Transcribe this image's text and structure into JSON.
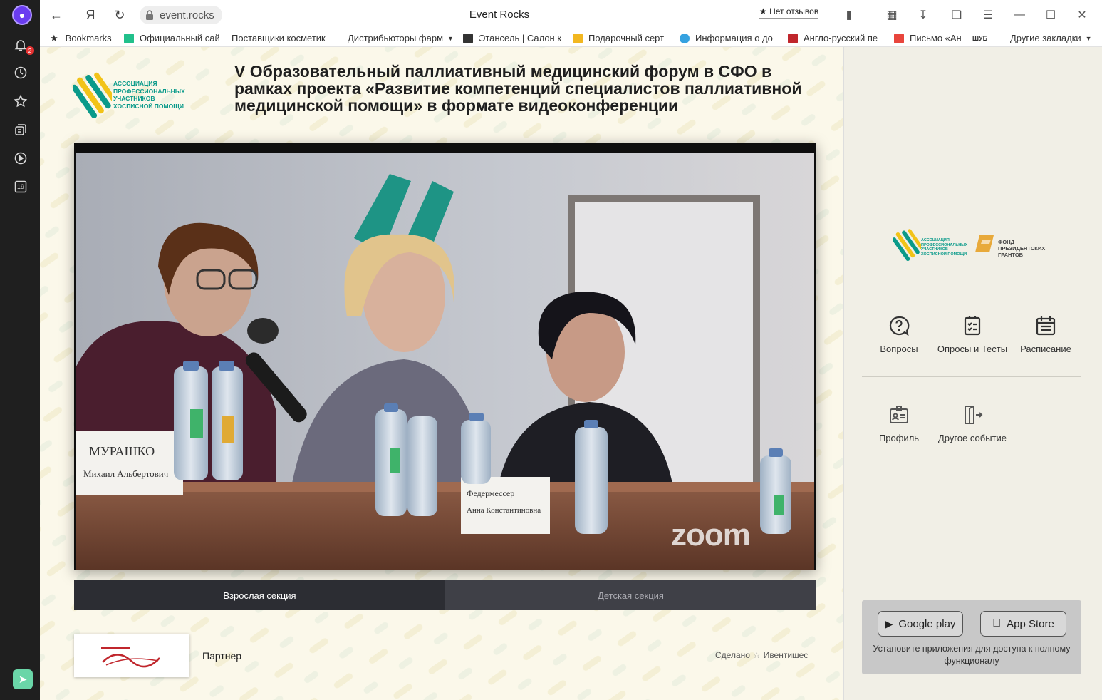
{
  "browser": {
    "tab_title": "Event Rocks",
    "address": "event.rocks",
    "yandex_btn": "Я",
    "reviews": "Нет отзывов",
    "notification_count": "2",
    "calendar_day": "19"
  },
  "bookmarks": [
    {
      "label": "Bookmarks",
      "color": "#333333"
    },
    {
      "label": "Официальный сай",
      "color": "#21c08b"
    },
    {
      "label": "Поставщики косметик",
      "color": "#ffffff"
    },
    {
      "label": "Дистрибьюторы фарм",
      "color": "#ffffff"
    },
    {
      "label": "Этансель | Салон к",
      "color": "#333333"
    },
    {
      "label": "Подарочный серт",
      "color": "#f2b720"
    },
    {
      "label": "Информация о до",
      "color": "#36a2e0"
    },
    {
      "label": "Англо-русский пе",
      "color": "#c0262c"
    },
    {
      "label": "Письмо «Ан",
      "color": "#e8453c"
    },
    {
      "label": "ШУБ",
      "color": "#ffffff"
    },
    {
      "label": "Другие закладки",
      "color": "#ffffff"
    }
  ],
  "header": {
    "logo_text": "АССОЦИАЦИЯ ПРОФЕССИОНАЛЬНЫХ УЧАСТНИКОВ ХОСПИСНОЙ ПОМОЩИ",
    "title": "V Образовательный паллиативный медицинский форум в СФО в рамках проекта «Развитие компетенций специалистов паллиативной медицинской помощи» в формате видеоконференции"
  },
  "video": {
    "watermark": "zoom",
    "nameplate_1": "МУРАШКО Михаил Альбертович",
    "nameplate_2": "Федермессер Анна Константиновна"
  },
  "tabs": [
    {
      "label": "Взрослая секция",
      "active": true
    },
    {
      "label": "Детская секция",
      "active": false
    }
  ],
  "footer": {
    "partner": "Партнер",
    "made_prefix": "Сделано",
    "made_by": "Ивентишес"
  },
  "right_panel": {
    "logo_assoc": "АССОЦИАЦИЯ ПРОФЕССИОНАЛЬНЫХ УЧАСТНИКОВ ХОСПИСНОЙ ПОМОЩИ",
    "logo_fund": "ФОНД ПРЕЗИДЕНТСКИХ ГРАНТОВ",
    "menu": [
      {
        "label": "Вопросы",
        "icon": "question-icon"
      },
      {
        "label": "Опросы и Тесты",
        "icon": "checklist-icon"
      },
      {
        "label": "Расписание",
        "icon": "calendar-icon"
      },
      {
        "label": "Профиль",
        "icon": "profile-card-icon"
      },
      {
        "label": "Другое событие",
        "icon": "exit-door-icon"
      }
    ],
    "google_play": "Google play",
    "app_store": "App Store",
    "app_note": "Установите приложения для доступа к полному функционалу"
  }
}
